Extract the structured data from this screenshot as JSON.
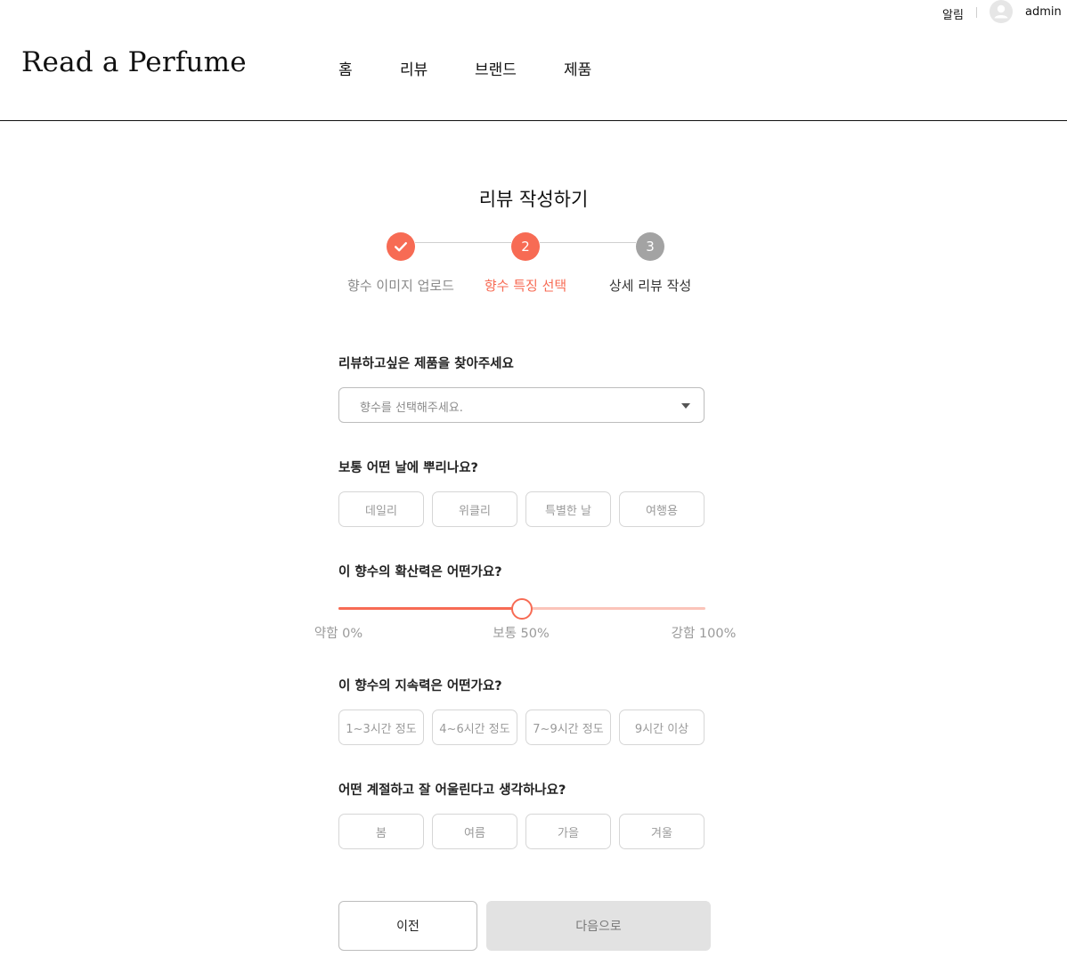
{
  "topbar": {
    "alert_label": "알림",
    "user_name": "admin",
    "avatar_icon": "user-icon"
  },
  "header": {
    "logo": "Read a Perfume",
    "nav": [
      {
        "label": "홈"
      },
      {
        "label": "리뷰"
      },
      {
        "label": "브랜드"
      },
      {
        "label": "제품"
      }
    ]
  },
  "page": {
    "title": "리뷰 작성하기"
  },
  "steps": [
    {
      "number": "",
      "label": "향수 이미지 업로드",
      "state": "done",
      "icon": "check-icon"
    },
    {
      "number": "2",
      "label": "향수 특징 선택",
      "state": "active"
    },
    {
      "number": "3",
      "label": "상세 리뷰 작성",
      "state": "todo"
    }
  ],
  "product": {
    "question": "리뷰하고싶은 제품을 찾아주세요",
    "placeholder": "향수를 선택해주세요.",
    "caret_icon": "caret-down-icon"
  },
  "usage": {
    "question": "보통 어떤 날에 뿌리나요?",
    "options": [
      "데일리",
      "위클리",
      "특별한 날",
      "여행용"
    ]
  },
  "diffusion": {
    "question": "이 향수의 확산력은 어떤가요?",
    "value_percent": 50,
    "labels": [
      "약함 0%",
      "보통 50%",
      "강함 100%"
    ],
    "colors": {
      "fill": "#f76b54",
      "track": "#fbc4b9"
    }
  },
  "longevity": {
    "question": "이 향수의 지속력은 어떤가요?",
    "options": [
      "1~3시간 정도",
      "4~6시간 정도",
      "7~9시간 정도",
      "9시간 이상"
    ]
  },
  "season": {
    "question": "어떤 계절하고 잘 어울린다고 생각하나요?",
    "options": [
      "봄",
      "여름",
      "가을",
      "겨울"
    ]
  },
  "actions": {
    "prev_label": "이전",
    "next_label": "다음으로"
  },
  "colors": {
    "accent": "#f76b54",
    "inactive_step": "#a3a3a3",
    "disabled_button": "#e2e2e2"
  }
}
